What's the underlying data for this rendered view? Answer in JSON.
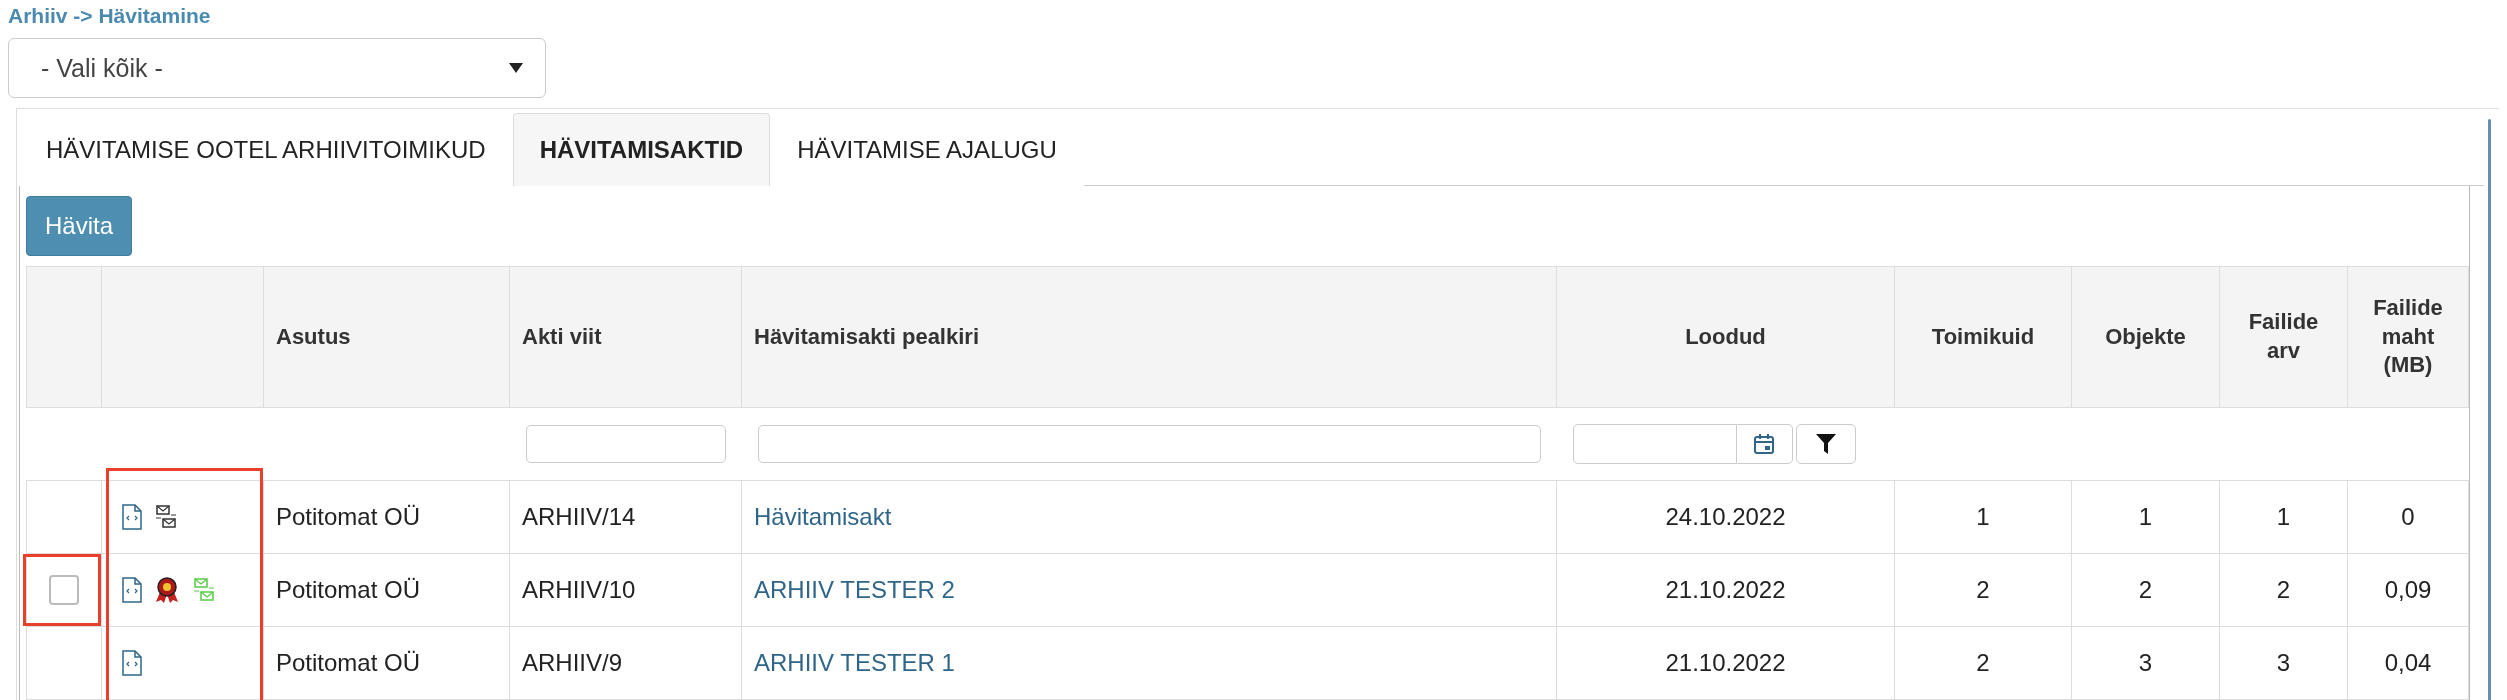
{
  "breadcrumb": "Arhiiv -> Hävitamine",
  "select": {
    "value": "- Vali kõik -"
  },
  "tabs": [
    {
      "label": "HÄVITAMISE OOTEL ARHIIVITOIMIKUD",
      "selected": false
    },
    {
      "label": "HÄVITAMISAKTID",
      "selected": true
    },
    {
      "label": "HÄVITAMISE AJALUGU",
      "selected": false
    }
  ],
  "action_button": "Hävita",
  "table": {
    "columns": [
      "Asutus",
      "Akti viit",
      "Hävitamisakti pealkiri",
      "Loodud",
      "Toimikuid",
      "Objekte",
      "Failide arv",
      "Failide maht (MB)"
    ],
    "filters": [
      {
        "kind": "none"
      },
      {
        "kind": "text"
      },
      {
        "kind": "text"
      },
      {
        "kind": "date"
      },
      {
        "kind": "none"
      },
      {
        "kind": "none"
      },
      {
        "kind": "none"
      },
      {
        "kind": "none"
      }
    ],
    "highlight_icon_column": true,
    "rows": [
      {
        "icons": [
          {
            "kind": "document"
          },
          {
            "kind": "mail-gray"
          }
        ],
        "cells": [
          "Potitomat OÜ",
          "ARHIIV/14",
          "Hävitamisakt",
          "24.10.2022",
          "1",
          "1",
          "1",
          "0"
        ]
      },
      {
        "checkbox": {
          "checked": false,
          "highlighted": true
        },
        "icons": [
          {
            "kind": "document"
          },
          {
            "kind": "award"
          },
          {
            "kind": "mail-green"
          }
        ],
        "cells": [
          "Potitomat OÜ",
          "ARHIIV/10",
          "ARHIIV TESTER 2",
          "21.10.2022",
          "2",
          "2",
          "2",
          "0,09"
        ]
      },
      {
        "icons": [
          {
            "kind": "document"
          }
        ],
        "cells": [
          "Potitomat OÜ",
          "ARHIIV/9",
          "ARHIIV TESTER 1",
          "21.10.2022",
          "2",
          "3",
          "3",
          "0,04"
        ]
      }
    ]
  }
}
